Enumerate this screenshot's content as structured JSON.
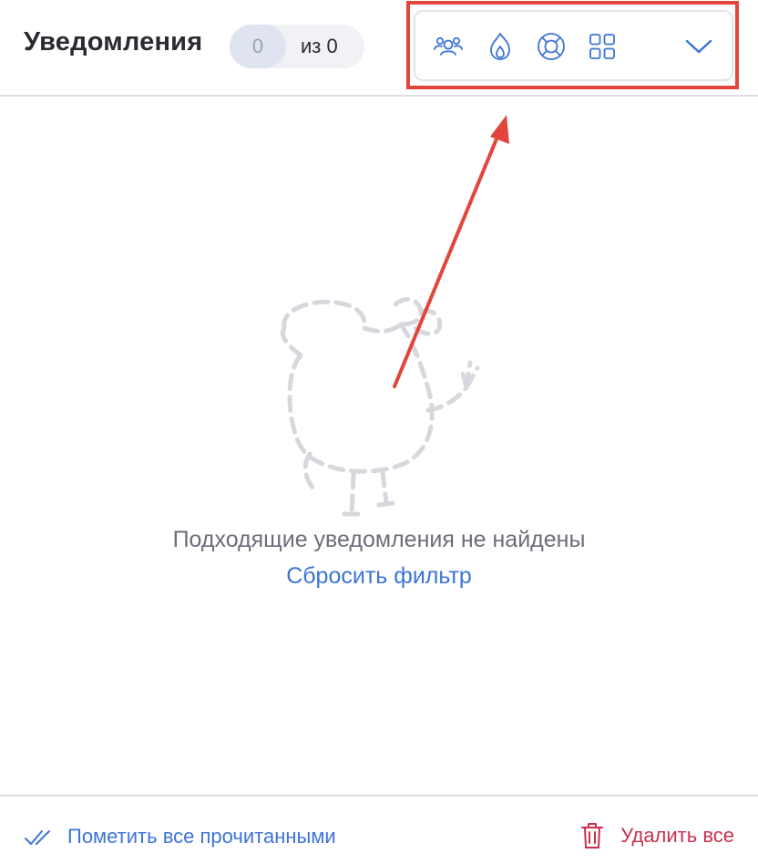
{
  "header": {
    "title": "Уведомления",
    "counter": {
      "current": "0",
      "total": "из 0"
    }
  },
  "filters": [
    {
      "icon": "people-icon"
    },
    {
      "icon": "fire-icon"
    },
    {
      "icon": "lifebuoy-icon"
    },
    {
      "icon": "grid-icon"
    },
    {
      "icon": "chevron-down-icon"
    }
  ],
  "empty_state": {
    "illustration": "dashed-bird-waving-illustration",
    "message": "Подходящие уведомления не найдены",
    "reset_label": "Сбросить фильтр"
  },
  "footer": {
    "mark_all_label": "Пометить все прочитанными",
    "delete_all_label": "Удалить все"
  },
  "colors": {
    "accent": "#3d74d6",
    "danger": "#c8314f",
    "highlight": "#e2453b",
    "illustration": "#d7d8de",
    "text": "#2a2a33",
    "muted": "#6d6d7a"
  }
}
